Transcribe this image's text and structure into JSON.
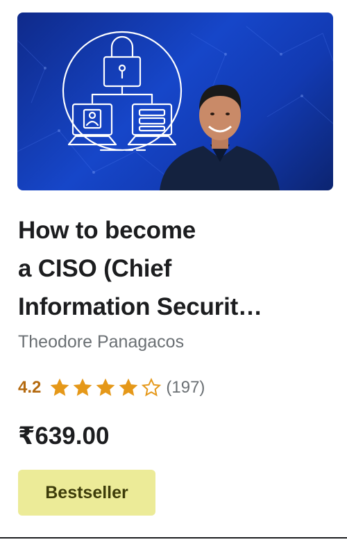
{
  "course": {
    "title_lines": [
      "How to become",
      "a CISO (Chief",
      "Information Securit…"
    ],
    "instructor": "Theodore Panagacos",
    "rating": "4.2",
    "rating_value": 4.2,
    "rating_count": "(197)",
    "price": "₹639.00",
    "badge": "Bestseller"
  },
  "colors": {
    "star": "#e59819",
    "rating_text": "#b4690e",
    "badge_bg": "#eceb98",
    "thumbnail_bg": "#1646c9"
  },
  "icons": {
    "thumbnail_graphic": "lock-network-icon",
    "star": "star-icon"
  }
}
